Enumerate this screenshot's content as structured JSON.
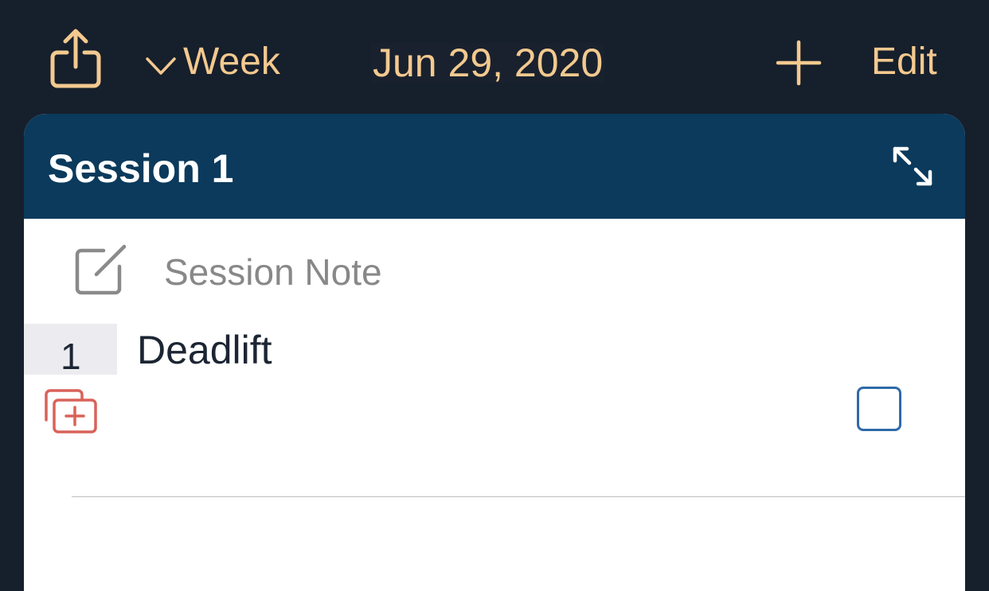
{
  "navbar": {
    "share_icon": "share-icon",
    "week_label": "Week",
    "week_icon": "chevron-down-icon",
    "date_title": "Jun 29, 2020",
    "add_icon": "plus-icon",
    "edit_label": "Edit"
  },
  "session": {
    "title": "Session 1",
    "expand_icon": "expand-icon",
    "note_icon": "compose-icon",
    "note_placeholder": "Session Note"
  },
  "exercise": {
    "index": "1",
    "name": "Deadlift",
    "add_set_icon": "add-set-icon",
    "checkbox_checked": false
  },
  "colors": {
    "background": "#161f2c",
    "accent": "#f3c98f",
    "header": "#0b3a5c",
    "add_set": "#d9625a",
    "checkbox": "#2e6aa8"
  }
}
